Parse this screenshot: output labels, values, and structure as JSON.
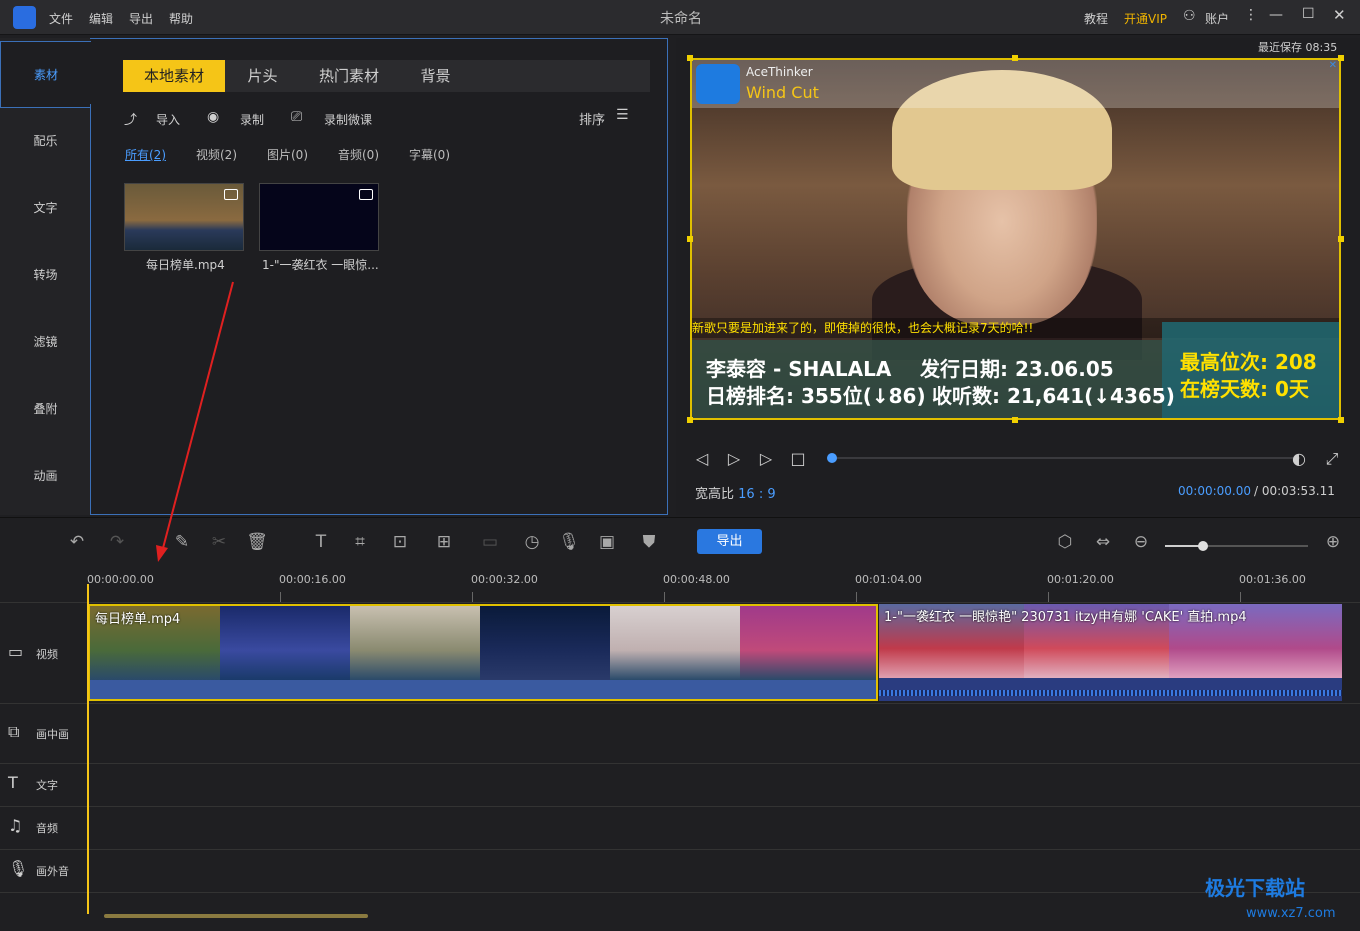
{
  "titlebar": {
    "menu": [
      "文件",
      "编辑",
      "导出",
      "帮助"
    ],
    "title": "未命名",
    "tutorial": "教程",
    "vip": "开通VIP",
    "account": "账户"
  },
  "sidebar": {
    "items": [
      {
        "label": "素材",
        "active": true
      },
      {
        "label": "配乐"
      },
      {
        "label": "文字"
      },
      {
        "label": "转场"
      },
      {
        "label": "滤镜"
      },
      {
        "label": "叠附"
      },
      {
        "label": "动画"
      }
    ]
  },
  "media": {
    "tabs": [
      "本地素材",
      "片头",
      "热门素材",
      "背景"
    ],
    "actions": {
      "import": "导入",
      "record": "录制",
      "record_lesson": "录制微课",
      "sort": "排序"
    },
    "filters": [
      "所有(2)",
      "视频(2)",
      "图片(0)",
      "音频(0)",
      "字幕(0)"
    ],
    "items": [
      {
        "label": "每日榜单.mp4"
      },
      {
        "label": "1-\"一袭红衣 一眼惊..."
      }
    ]
  },
  "preview": {
    "last_saved": "最近保存 08:35",
    "watermark_brand": "AceThinker",
    "watermark_product": "Wind Cut",
    "subtitle": "新歌只要是加进来了的，即使掉的很快，也会大概记录7天的哈!!",
    "info_line1_a": "李泰容 - SHALALA",
    "info_line1_b": "发行日期: 23.06.05",
    "info_line2_a": "日榜排名: 355位(↓86)",
    "info_line2_b": "收听数: 21,641(↓4365)",
    "info_right1": "最高位次: 208",
    "info_right2": "在榜天数: 0天",
    "aspect_label": "宽高比",
    "aspect_value": "16 : 9",
    "time_current": "00:00:00.00",
    "time_total": "/  00:03:53.11",
    "progress": 0
  },
  "toolbar": {
    "export_label": "导出"
  },
  "timeline": {
    "ticks": [
      "00:00:00.00",
      "00:00:16.00",
      "00:00:32.00",
      "00:00:48.00",
      "00:01:04.00",
      "00:01:20.00",
      "00:01:36.00"
    ],
    "tracks": [
      "视频",
      "画中画",
      "文字",
      "音频",
      "画外音"
    ],
    "clips": [
      {
        "title": "每日榜单.mp4"
      },
      {
        "title": "1-\"一袭红衣 一眼惊艳\" 230731 itzy申有娜 'CAKE' 直拍.mp4"
      }
    ]
  },
  "site": {
    "logo": "极光下载站",
    "url": "www.xz7.com"
  },
  "colors": {
    "accent": "#4a9dff",
    "tab_active": "#f5c517",
    "export": "#2a78e0"
  }
}
